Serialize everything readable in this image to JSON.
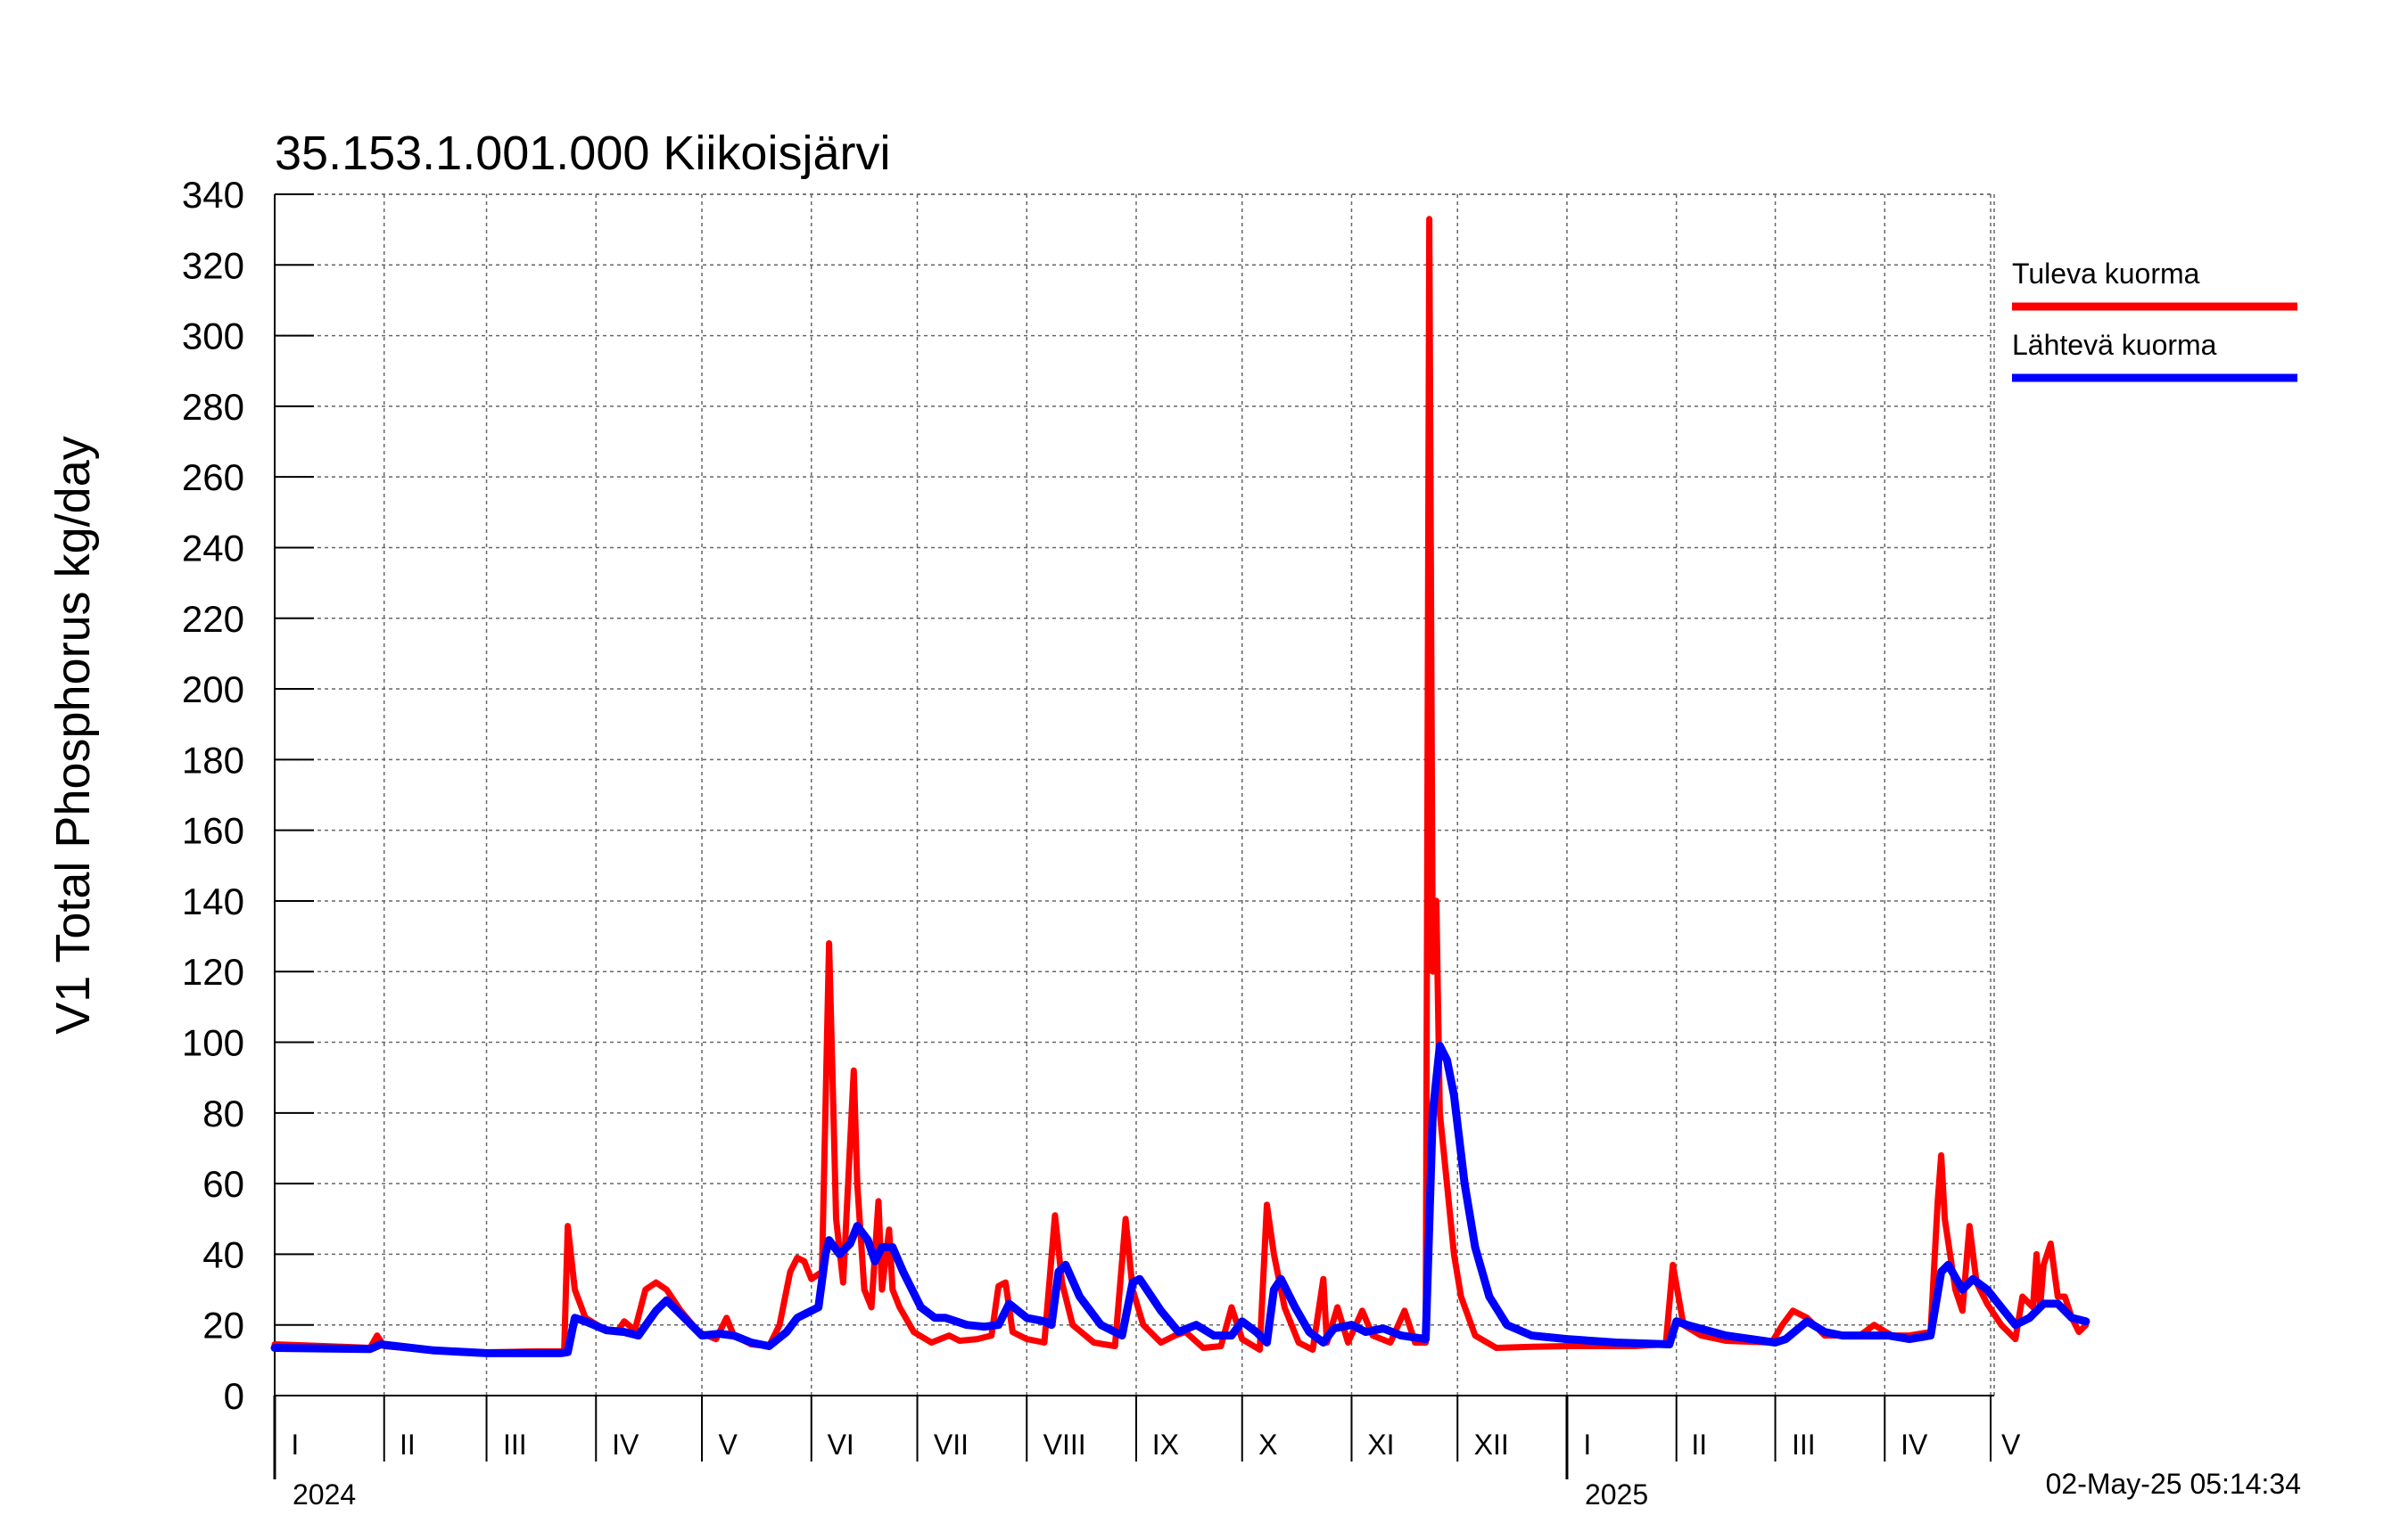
{
  "chart_data": {
    "type": "line",
    "title": "35.153.1.001.000 Kiikoisjärvi",
    "ylabel": "V1 Total Phosphorus kg/day",
    "ylim": [
      0,
      340
    ],
    "yticks": [
      0,
      20,
      40,
      60,
      80,
      100,
      120,
      140,
      160,
      180,
      200,
      220,
      240,
      260,
      280,
      300,
      320,
      340
    ],
    "xlim": [
      "2024-01-01",
      "2025-05-02"
    ],
    "months": [
      {
        "label": "I",
        "start": "2024-01-01"
      },
      {
        "label": "II",
        "start": "2024-02-01"
      },
      {
        "label": "III",
        "start": "2024-03-01"
      },
      {
        "label": "IV",
        "start": "2024-04-01"
      },
      {
        "label": "V",
        "start": "2024-05-01"
      },
      {
        "label": "VI",
        "start": "2024-06-01"
      },
      {
        "label": "VII",
        "start": "2024-07-01"
      },
      {
        "label": "VIII",
        "start": "2024-08-01"
      },
      {
        "label": "IX",
        "start": "2024-09-01"
      },
      {
        "label": "X",
        "start": "2024-10-01"
      },
      {
        "label": "XI",
        "start": "2024-11-01"
      },
      {
        "label": "XII",
        "start": "2024-12-01"
      },
      {
        "label": "I",
        "start": "2025-01-01"
      },
      {
        "label": "II",
        "start": "2025-02-01"
      },
      {
        "label": "III",
        "start": "2025-03-01"
      },
      {
        "label": "IV",
        "start": "2025-04-01"
      },
      {
        "label": "V",
        "start": "2025-05-01"
      }
    ],
    "years": [
      {
        "label": "2024",
        "date": "2024-01-01"
      },
      {
        "label": "2025",
        "date": "2025-01-01"
      }
    ],
    "grid": true,
    "legend_position": "right",
    "series": [
      {
        "name": "Tuleva kuorma",
        "color": "#ff0000",
        "points": [
          [
            "2024-01-01",
            14.5
          ],
          [
            "2024-01-15",
            14.0
          ],
          [
            "2024-01-28",
            13.5
          ],
          [
            "2024-01-30",
            17.0
          ],
          [
            "2024-02-01",
            14.0
          ],
          [
            "2024-02-15",
            12.8
          ],
          [
            "2024-03-01",
            12.2
          ],
          [
            "2024-03-15",
            12.5
          ],
          [
            "2024-03-23",
            12.5
          ],
          [
            "2024-03-24",
            48.0
          ],
          [
            "2024-03-26",
            30.0
          ],
          [
            "2024-03-29",
            22.0
          ],
          [
            "2024-04-03",
            19.0
          ],
          [
            "2024-04-07",
            18.0
          ],
          [
            "2024-04-09",
            21.0
          ],
          [
            "2024-04-12",
            18.5
          ],
          [
            "2024-04-15",
            30.0
          ],
          [
            "2024-04-18",
            32.0
          ],
          [
            "2024-04-21",
            30.0
          ],
          [
            "2024-04-25",
            24.0
          ],
          [
            "2024-04-30",
            18.0
          ],
          [
            "2024-05-05",
            16.0
          ],
          [
            "2024-05-08",
            22.0
          ],
          [
            "2024-05-10",
            17.0
          ],
          [
            "2024-05-15",
            14.5
          ],
          [
            "2024-05-20",
            14.0
          ],
          [
            "2024-05-23",
            20.0
          ],
          [
            "2024-05-26",
            35.0
          ],
          [
            "2024-05-28",
            39.0
          ],
          [
            "2024-05-30",
            38.0
          ],
          [
            "2024-06-01",
            33.0
          ],
          [
            "2024-06-04",
            35.0
          ],
          [
            "2024-06-06",
            128.0
          ],
          [
            "2024-06-07",
            90.0
          ],
          [
            "2024-06-08",
            50.0
          ],
          [
            "2024-06-10",
            32.0
          ],
          [
            "2024-06-13",
            92.0
          ],
          [
            "2024-06-14",
            60.0
          ],
          [
            "2024-06-16",
            30.0
          ],
          [
            "2024-06-18",
            25.0
          ],
          [
            "2024-06-20",
            55.0
          ],
          [
            "2024-06-21",
            30.0
          ],
          [
            "2024-06-23",
            47.0
          ],
          [
            "2024-06-24",
            30.0
          ],
          [
            "2024-06-26",
            25.0
          ],
          [
            "2024-06-30",
            18.0
          ],
          [
            "2024-07-05",
            15.0
          ],
          [
            "2024-07-10",
            17.0
          ],
          [
            "2024-07-13",
            15.5
          ],
          [
            "2024-07-18",
            16.0
          ],
          [
            "2024-07-22",
            17.0
          ],
          [
            "2024-07-24",
            31.0
          ],
          [
            "2024-07-26",
            32.0
          ],
          [
            "2024-07-28",
            18.0
          ],
          [
            "2024-08-01",
            16.0
          ],
          [
            "2024-08-06",
            15.0
          ],
          [
            "2024-08-09",
            51.0
          ],
          [
            "2024-08-11",
            32.0
          ],
          [
            "2024-08-14",
            20.0
          ],
          [
            "2024-08-20",
            15.0
          ],
          [
            "2024-08-26",
            14.0
          ],
          [
            "2024-08-29",
            50.0
          ],
          [
            "2024-08-31",
            30.0
          ],
          [
            "2024-09-03",
            20.0
          ],
          [
            "2024-09-08",
            15.0
          ],
          [
            "2024-09-12",
            17.0
          ],
          [
            "2024-09-15",
            18.0
          ],
          [
            "2024-09-20",
            13.5
          ],
          [
            "2024-09-25",
            14.0
          ],
          [
            "2024-09-28",
            25.0
          ],
          [
            "2024-10-01",
            16.0
          ],
          [
            "2024-10-06",
            13.0
          ],
          [
            "2024-10-08",
            54.0
          ],
          [
            "2024-10-10",
            40.0
          ],
          [
            "2024-10-13",
            25.0
          ],
          [
            "2024-10-17",
            15.0
          ],
          [
            "2024-10-21",
            13.0
          ],
          [
            "2024-10-24",
            33.0
          ],
          [
            "2024-10-25",
            15.0
          ],
          [
            "2024-10-28",
            25.0
          ],
          [
            "2024-10-31",
            15.0
          ],
          [
            "2024-11-04",
            24.0
          ],
          [
            "2024-11-07",
            17.0
          ],
          [
            "2024-11-12",
            15.0
          ],
          [
            "2024-11-16",
            24.0
          ],
          [
            "2024-11-19",
            15.0
          ],
          [
            "2024-11-22",
            15.0
          ],
          [
            "2024-11-23",
            333.0
          ],
          [
            "2024-11-24",
            120.0
          ],
          [
            "2024-11-25",
            140.0
          ],
          [
            "2024-11-26",
            80.0
          ],
          [
            "2024-11-28",
            60.0
          ],
          [
            "2024-11-30",
            40.0
          ],
          [
            "2024-12-02",
            28.0
          ],
          [
            "2024-12-06",
            17.0
          ],
          [
            "2024-12-12",
            13.5
          ],
          [
            "2024-12-22",
            13.8
          ],
          [
            "2025-01-01",
            14.0
          ],
          [
            "2025-01-20",
            14.0
          ],
          [
            "2025-01-29",
            14.5
          ],
          [
            "2025-01-31",
            37.0
          ],
          [
            "2025-02-03",
            20.0
          ],
          [
            "2025-02-08",
            17.0
          ],
          [
            "2025-02-15",
            15.5
          ],
          [
            "2025-02-28",
            15.0
          ],
          [
            "2025-03-03",
            20.0
          ],
          [
            "2025-03-06",
            24.0
          ],
          [
            "2025-03-10",
            22.0
          ],
          [
            "2025-03-15",
            17.0
          ],
          [
            "2025-03-25",
            17.0
          ],
          [
            "2025-03-29",
            20.0
          ],
          [
            "2025-04-03",
            17.0
          ],
          [
            "2025-04-08",
            17.0
          ],
          [
            "2025-04-14",
            18.0
          ],
          [
            "2025-04-16",
            55.0
          ],
          [
            "2025-04-17",
            68.0
          ],
          [
            "2025-04-18",
            50.0
          ],
          [
            "2025-04-21",
            30.0
          ],
          [
            "2025-04-23",
            24.0
          ],
          [
            "2025-04-25",
            48.0
          ],
          [
            "2025-04-27",
            32.0
          ],
          [
            "2025-04-30",
            26.0
          ],
          [
            "2025-05-04",
            20.0
          ],
          [
            "2025-05-08",
            16.0
          ],
          [
            "2025-05-10",
            28.0
          ],
          [
            "2025-05-13",
            25.0
          ],
          [
            "2025-05-14",
            40.0
          ],
          [
            "2025-05-15",
            25.0
          ],
          [
            "2025-05-16",
            37.0
          ],
          [
            "2025-05-18",
            43.0
          ],
          [
            "2025-05-20",
            28.0
          ],
          [
            "2025-05-22",
            28.0
          ],
          [
            "2025-05-24",
            22.0
          ],
          [
            "2025-05-26",
            18.0
          ],
          [
            "2025-05-28",
            20.0
          ]
        ]
      },
      {
        "name": "Lähtevä kuorma",
        "color": "#0000ff",
        "points": [
          [
            "2024-01-01",
            13.5
          ],
          [
            "2024-01-28",
            13.2
          ],
          [
            "2024-01-31",
            14.5
          ],
          [
            "2024-02-15",
            12.8
          ],
          [
            "2024-03-01",
            12.0
          ],
          [
            "2024-03-22",
            12.0
          ],
          [
            "2024-03-24",
            12.3
          ],
          [
            "2024-03-26",
            22.0
          ],
          [
            "2024-03-29",
            21.0
          ],
          [
            "2024-04-04",
            18.5
          ],
          [
            "2024-04-09",
            18.0
          ],
          [
            "2024-04-13",
            17.0
          ],
          [
            "2024-04-18",
            24.0
          ],
          [
            "2024-04-21",
            27.0
          ],
          [
            "2024-04-25",
            23.0
          ],
          [
            "2024-05-01",
            17.0
          ],
          [
            "2024-05-06",
            17.5
          ],
          [
            "2024-05-10",
            17.0
          ],
          [
            "2024-05-15",
            15.0
          ],
          [
            "2024-05-20",
            14.0
          ],
          [
            "2024-05-25",
            18.0
          ],
          [
            "2024-05-28",
            22.0
          ],
          [
            "2024-06-01",
            24.0
          ],
          [
            "2024-06-03",
            25.0
          ],
          [
            "2024-06-05",
            40.0
          ],
          [
            "2024-06-06",
            44.0
          ],
          [
            "2024-06-09",
            40.0
          ],
          [
            "2024-06-12",
            43.0
          ],
          [
            "2024-06-14",
            48.0
          ],
          [
            "2024-06-17",
            44.0
          ],
          [
            "2024-06-19",
            38.0
          ],
          [
            "2024-06-21",
            42.0
          ],
          [
            "2024-06-24",
            42.0
          ],
          [
            "2024-06-27",
            35.0
          ],
          [
            "2024-07-02",
            25.0
          ],
          [
            "2024-07-06",
            22.0
          ],
          [
            "2024-07-09",
            22.0
          ],
          [
            "2024-07-15",
            20.0
          ],
          [
            "2024-07-20",
            19.5
          ],
          [
            "2024-07-24",
            20.0
          ],
          [
            "2024-07-27",
            26.0
          ],
          [
            "2024-08-01",
            22.0
          ],
          [
            "2024-08-06",
            21.0
          ],
          [
            "2024-08-08",
            20.0
          ],
          [
            "2024-08-10",
            35.0
          ],
          [
            "2024-08-12",
            37.0
          ],
          [
            "2024-08-16",
            28.0
          ],
          [
            "2024-08-22",
            20.0
          ],
          [
            "2024-08-28",
            17.0
          ],
          [
            "2024-08-31",
            32.0
          ],
          [
            "2024-09-02",
            33.0
          ],
          [
            "2024-09-08",
            24.0
          ],
          [
            "2024-09-13",
            18.0
          ],
          [
            "2024-09-18",
            20.0
          ],
          [
            "2024-09-23",
            17.0
          ],
          [
            "2024-09-28",
            17.0
          ],
          [
            "2024-10-01",
            21.0
          ],
          [
            "2024-10-05",
            18.0
          ],
          [
            "2024-10-08",
            15.0
          ],
          [
            "2024-10-10",
            30.0
          ],
          [
            "2024-10-12",
            33.0
          ],
          [
            "2024-10-16",
            25.0
          ],
          [
            "2024-10-20",
            18.0
          ],
          [
            "2024-10-24",
            15.0
          ],
          [
            "2024-10-27",
            19.0
          ],
          [
            "2024-11-01",
            20.0
          ],
          [
            "2024-11-05",
            18.0
          ],
          [
            "2024-11-10",
            19.0
          ],
          [
            "2024-11-15",
            17.0
          ],
          [
            "2024-11-22",
            16.0
          ],
          [
            "2024-11-24",
            80.0
          ],
          [
            "2024-11-26",
            99.0
          ],
          [
            "2024-11-28",
            95.0
          ],
          [
            "2024-11-30",
            85.0
          ],
          [
            "2024-12-03",
            60.0
          ],
          [
            "2024-12-06",
            42.0
          ],
          [
            "2024-12-10",
            28.0
          ],
          [
            "2024-12-15",
            20.0
          ],
          [
            "2024-12-22",
            17.0
          ],
          [
            "2025-01-01",
            16.0
          ],
          [
            "2025-01-15",
            15.0
          ],
          [
            "2025-01-30",
            14.5
          ],
          [
            "2025-02-01",
            21.0
          ],
          [
            "2025-02-04",
            20.0
          ],
          [
            "2025-02-15",
            17.0
          ],
          [
            "2025-03-01",
            15.0
          ],
          [
            "2025-03-04",
            16.0
          ],
          [
            "2025-03-10",
            21.0
          ],
          [
            "2025-03-15",
            18.0
          ],
          [
            "2025-03-20",
            17.0
          ],
          [
            "2025-03-28",
            17.0
          ],
          [
            "2025-04-02",
            17.0
          ],
          [
            "2025-04-08",
            16.0
          ],
          [
            "2025-04-14",
            17.0
          ],
          [
            "2025-04-17",
            35.0
          ],
          [
            "2025-04-19",
            37.0
          ],
          [
            "2025-04-23",
            30.0
          ],
          [
            "2025-04-26",
            33.0
          ],
          [
            "2025-04-30",
            30.0
          ],
          [
            "2025-05-04",
            25.0
          ],
          [
            "2025-05-08",
            20.0
          ],
          [
            "2025-05-12",
            22.0
          ],
          [
            "2025-05-16",
            26.0
          ],
          [
            "2025-05-20",
            26.0
          ],
          [
            "2025-05-24",
            22.0
          ],
          [
            "2025-05-28",
            21.0
          ]
        ]
      }
    ],
    "timestamp": "02-May-25 05:14:34"
  }
}
